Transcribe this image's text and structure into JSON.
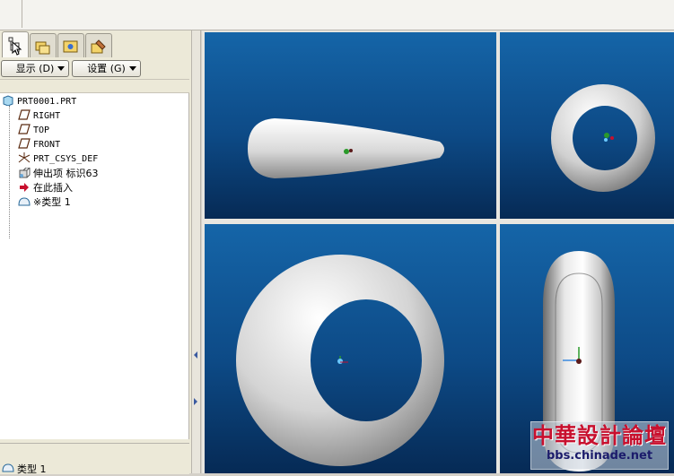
{
  "toolbar": {
    "display_label": "显示",
    "display_key": "(D)",
    "settings_label": "设置",
    "settings_key": "(G)"
  },
  "model_tree": {
    "root": "PRT0001.PRT",
    "items": [
      {
        "label": "RIGHT",
        "icon": "datum-plane-icon"
      },
      {
        "label": "TOP",
        "icon": "datum-plane-icon"
      },
      {
        "label": "FRONT",
        "icon": "datum-plane-icon"
      },
      {
        "label": "PRT_CSYS_DEF",
        "icon": "csys-icon"
      },
      {
        "label": "伸出项 标识63",
        "icon": "protrusion-icon"
      },
      {
        "label": "在此插入",
        "icon": "insert-here-arrow-icon"
      },
      {
        "label": "※类型 1",
        "icon": "feature-icon"
      }
    ]
  },
  "bottom_panel": {
    "label": "类型 1"
  },
  "watermark": {
    "title": "中華設計論壇",
    "url": "bbs.chinade.net"
  },
  "colors": {
    "viewport_top": "#1565a8",
    "viewport_bottom": "#062a55",
    "watermark_red": "#c8102e"
  }
}
